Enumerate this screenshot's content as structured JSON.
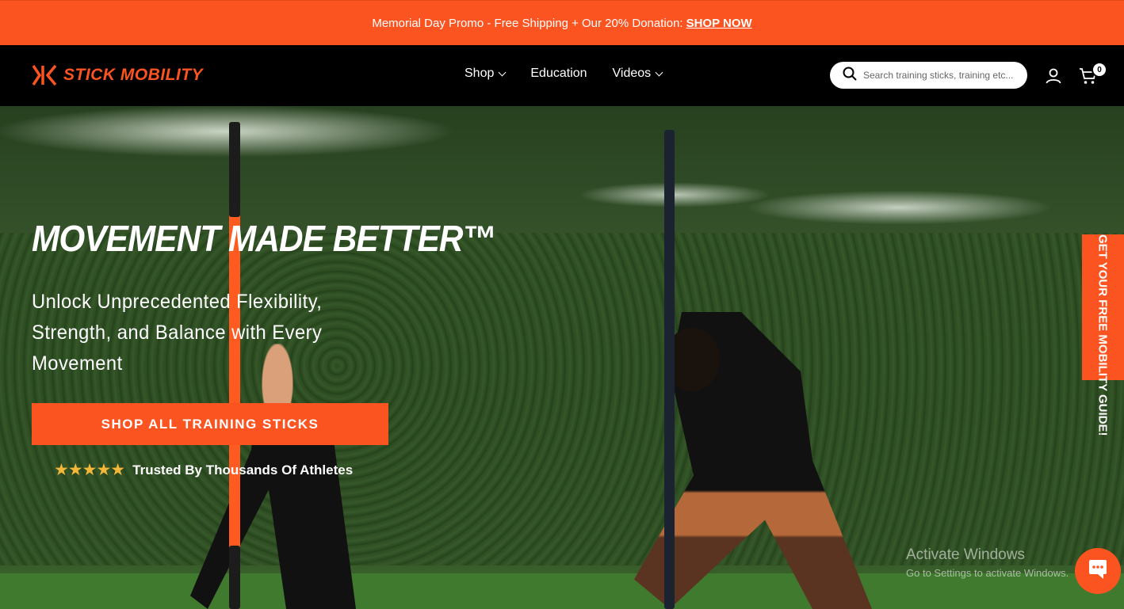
{
  "promo": {
    "text": "Memorial Day Promo - Free Shipping + Our 20% Donation:",
    "link_label": "SHOP NOW"
  },
  "header": {
    "logo_text": "STICK MOBILITY",
    "nav": [
      {
        "label": "Shop",
        "has_dropdown": true
      },
      {
        "label": "Education",
        "has_dropdown": false
      },
      {
        "label": "Videos",
        "has_dropdown": true
      }
    ],
    "search": {
      "placeholder": "Search training sticks, training etc...",
      "icon": "search-icon"
    },
    "account_icon": "user-icon",
    "cart_icon": "cart-icon",
    "cart_count": "0"
  },
  "hero": {
    "title": "MOVEMENT MADE BETTER™",
    "subtitle": "Unlock Unprecedented Flexibility, Strength, and Balance with Every Movement",
    "cta_label": "SHOP ALL TRAINING STICKS",
    "stars": "★★★★★",
    "rating_text": "Trusted By Thousands Of Athletes"
  },
  "side_tab": {
    "label": "GET YOUR FREE MOBILITY GUIDE!"
  },
  "watermark": {
    "line1": "Activate Windows",
    "line2": "Go to Settings to activate Windows."
  },
  "chat": {
    "icon": "chat-bubble-icon"
  },
  "colors": {
    "accent": "#fc5420",
    "header_bg": "#000000",
    "star": "#f5b73a"
  }
}
